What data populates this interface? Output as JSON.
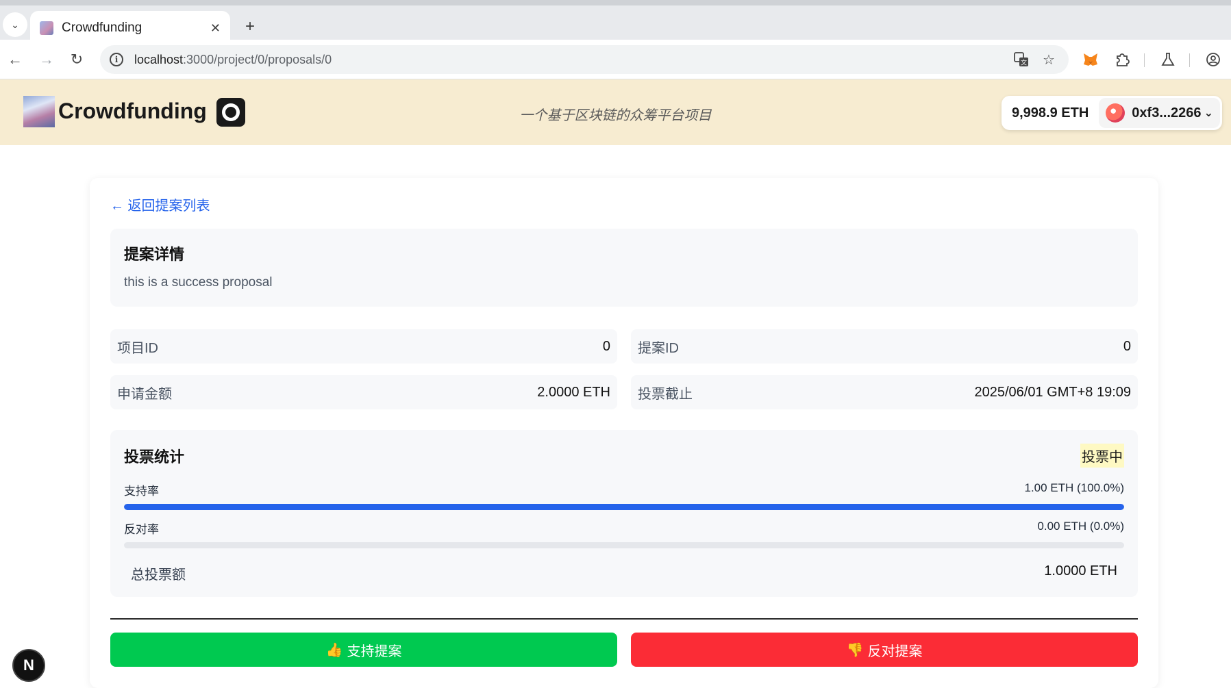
{
  "browser": {
    "tab_title": "Crowdfunding",
    "url_host": "localhost",
    "url_rest": ":3000/project/0/proposals/0"
  },
  "header": {
    "brand": "Crowdfunding",
    "tagline": "一个基于区块链的众筹平台项目",
    "balance": "9,998.9 ETH",
    "account": "0xf3...2266"
  },
  "page": {
    "back_link": "← 返回提案列表",
    "detail": {
      "title": "提案详情",
      "description": "this is a success proposal"
    },
    "info": {
      "project_id_label": "项目ID",
      "project_id_value": "0",
      "proposal_id_label": "提案ID",
      "proposal_id_value": "0",
      "amount_label": "申请金额",
      "amount_value": "2.0000 ETH",
      "deadline_label": "投票截止",
      "deadline_value": "2025/06/01 GMT+8 19:09"
    },
    "votes": {
      "title": "投票统计",
      "status": "投票中",
      "support_label": "支持率",
      "support_value": "1.00 ETH (100.0%)",
      "support_fraction": 1.0,
      "oppose_label": "反对率",
      "oppose_value": "0.00 ETH (0.0%)",
      "oppose_fraction": 0.0,
      "total_label": "总投票额",
      "total_value": "1.0000 ETH"
    },
    "actions": {
      "support_emoji": "👍",
      "support_label": "支持提案",
      "oppose_emoji": "👎",
      "oppose_label": "反对提案"
    }
  },
  "dev_badge": "N",
  "colors": {
    "header_bg": "#f7ecd1",
    "link": "#2563eb",
    "support": "#00c950",
    "oppose": "#fb2c36",
    "bar": "#2563eb"
  }
}
